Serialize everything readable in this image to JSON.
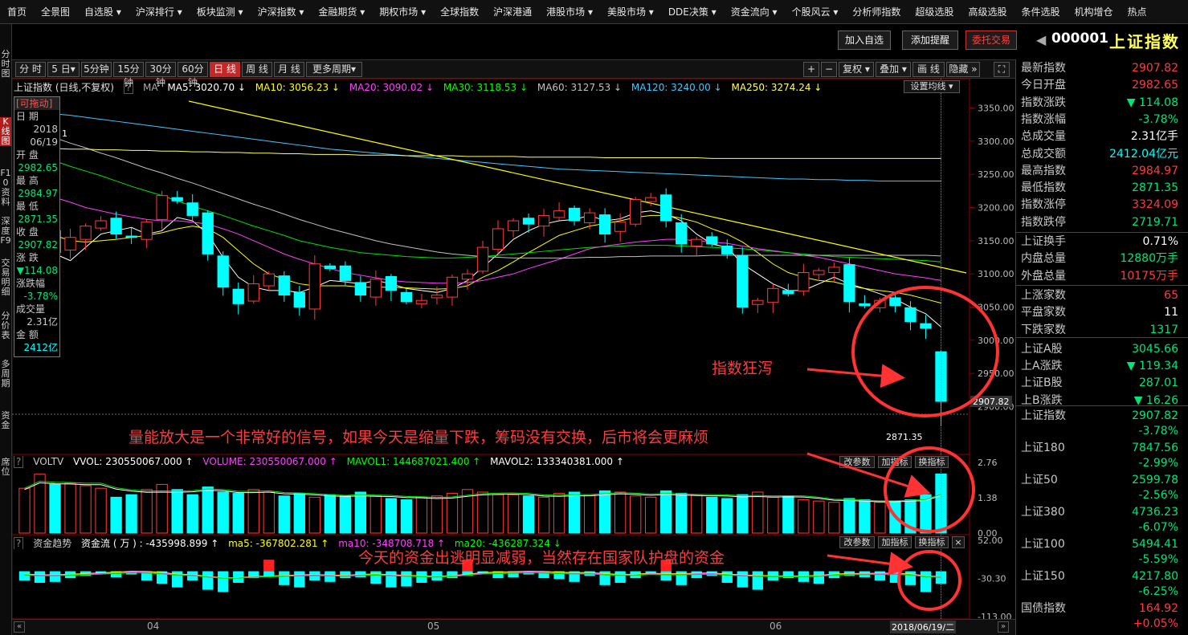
{
  "nav": [
    "首页",
    "全景图",
    "自选股 ▾",
    "沪深排行 ▾",
    "板块监测 ▾",
    "沪深指数 ▾",
    "金融期货 ▾",
    "期权市场 ▾",
    "全球指数",
    "沪深港通",
    "港股市场 ▾",
    "美股市场 ▾",
    "DDE决策 ▾",
    "资金流向 ▾",
    "个股风云 ▾",
    "分析师指数",
    "超级选股",
    "高级选股",
    "条件选股",
    "机构增仓",
    "热点"
  ],
  "leftbar": [
    "分时图",
    "K线图",
    "F10资料",
    "深度F9",
    "交易明细",
    "分价表",
    "多周期",
    "资金",
    "席位"
  ],
  "header": {
    "add_watch": "加入自选",
    "add_alert": "添加提醒",
    "trade": "委托交易",
    "code": "000001",
    "name": "上证指数"
  },
  "periods": [
    "分 时",
    "5 日▾",
    "5分钟",
    "15分钟",
    "30分钟",
    "60分钟",
    "日 线",
    "周 线",
    "月 线",
    "更多周期▾"
  ],
  "tools": [
    "+",
    "−",
    "复权 ▾",
    "叠加 ▾",
    "画 线",
    "隐藏 »"
  ],
  "ma_line": {
    "title": "上证指数 (日线,不复权)",
    "q": "?",
    "ma": "MA",
    "ma5": "MA5: 3020.70 ↓",
    "ma10": "MA10: 3056.23 ↓",
    "ma20": "MA20: 3090.02 ↓",
    "ma30": "MA30: 3118.53 ↓",
    "ma60": "MA60: 3127.53 ↓",
    "ma120": "MA120: 3240.00 ↓",
    "ma250": "MA250: 3274.24 ↓",
    "setting": "设置均线 ▾",
    "note": "1"
  },
  "info": {
    "drag": "[可拖动]",
    "date_lbl": "日  期",
    "year": "2018",
    "date": "06/19",
    "open_lbl": "开  盘",
    "open": "2982.65",
    "high_lbl": "最  高",
    "high": "2984.97",
    "low_lbl": "最  低",
    "low": "2871.35",
    "close_lbl": "收  盘",
    "close": "2907.82",
    "chg_lbl": "涨  跌",
    "chg": "▼114.08",
    "pct_lbl": "涨跌幅",
    "pct": "-3.78%",
    "vol_lbl": "成交量",
    "vol": "2.31亿",
    "amt_lbl": "金  额",
    "amt": "2412亿"
  },
  "price_axis": [
    "3350.00",
    "3300.00",
    "3250.00",
    "3200.00",
    "3150.00",
    "3100.00",
    "3050.00",
    "3000.00",
    "2950.00",
    "2900.00"
  ],
  "price_tag": "2907.82",
  "low_tag": "2871.35",
  "vol": {
    "name": "VOLTV",
    "vvol": "VVOL: 230550067.000 ↑",
    "volume": "VOLUME: 230550067.000 ↑",
    "mavol1": "MAVOL1: 144687021.400 ↑",
    "mavol2": "MAVOL2: 133340381.000 ↑",
    "axis": [
      "2.76",
      "1.38",
      "0.00"
    ]
  },
  "fund": {
    "name": "资金趋势",
    "flow": "资金流 ( 万 ) : -435998.899 ↑",
    "ma5": "ma5: -367802.281 ↑",
    "ma10": "ma10: -348708.718 ↑",
    "ma20": "ma20: -436287.324 ↓",
    "axis": [
      "52.00",
      "-30.30",
      "-113.00"
    ]
  },
  "sub_btns": [
    "改参数",
    "加指标",
    "换指标",
    "×"
  ],
  "dates": [
    "04",
    "05",
    "06",
    "2018/06/19/二"
  ],
  "anno": {
    "a1": "指数狂泻",
    "a2": "量能放大是一个非常好的信号，如果今天是缩量下跌，筹码没有交换，后市将会更麻烦",
    "a3": "今天的资金出逃明显减弱，当然存在国家队护盘的资金"
  },
  "quote": [
    {
      "l": "最新指数",
      "v": "2907.82",
      "c": "up"
    },
    {
      "l": "今日开盘",
      "v": "2982.65",
      "c": "up"
    },
    {
      "l": "指数涨跌",
      "v": "▼ 114.08",
      "c": "down"
    },
    {
      "l": "指数涨幅",
      "v": "-3.78%",
      "c": "down"
    },
    {
      "l": "总成交量",
      "v": "2.31亿手",
      "c": "wht"
    },
    {
      "l": "总成交额",
      "v": "2412.04亿元",
      "c": "cyan"
    },
    {
      "l": "最高指数",
      "v": "2984.97",
      "c": "up"
    },
    {
      "l": "最低指数",
      "v": "2871.35",
      "c": "down"
    },
    {
      "l": "指数涨停",
      "v": "3324.09",
      "c": "up"
    },
    {
      "l": "指数跌停",
      "v": "2719.71",
      "c": "down"
    },
    {
      "l": "上证换手",
      "v": "0.71%",
      "c": "wht"
    },
    {
      "l": "内盘总量",
      "v": "12880万手",
      "c": "down"
    },
    {
      "l": "外盘总量",
      "v": "10175万手",
      "c": "up"
    },
    {
      "l": "上涨家数",
      "v": "65",
      "c": "up"
    },
    {
      "l": "平盘家数",
      "v": "11",
      "c": "wht"
    },
    {
      "l": "下跌家数",
      "v": "1317",
      "c": "down"
    },
    {
      "l": "上证A股",
      "v": "3045.66",
      "c": "down"
    },
    {
      "l": "上A涨跌",
      "v": "▼ 119.34",
      "c": "down"
    },
    {
      "l": "上证B股",
      "v": "287.01",
      "c": "down"
    },
    {
      "l": "上B涨跌",
      "v": "▼ 16.26",
      "c": "down"
    }
  ],
  "indices": [
    {
      "l": "上证指数",
      "v": "2907.82",
      "p": "-3.78%"
    },
    {
      "l": "上证180",
      "v": "7847.56",
      "p": "-2.99%"
    },
    {
      "l": "上证50",
      "v": "2599.78",
      "p": "-2.56%"
    },
    {
      "l": "上证380",
      "v": "4736.23",
      "p": "-6.07%"
    },
    {
      "l": "上证100",
      "v": "5494.41",
      "p": "-5.59%"
    },
    {
      "l": "上证150",
      "v": "4217.80",
      "p": "-6.25%"
    },
    {
      "l": "国债指数",
      "v": "164.92",
      "p": "+0.05%"
    }
  ],
  "chart_data": {
    "type": "candlestick",
    "ylim": [
      2880,
      3370
    ],
    "close": [
      3130,
      3168,
      3132,
      3155,
      3172,
      3180,
      3160,
      3155,
      3178,
      3218,
      3210,
      3188,
      3130,
      3080,
      3055,
      3085,
      3100,
      3068,
      3050,
      3115,
      3108,
      3090,
      3068,
      3092,
      3075,
      3058,
      3060,
      3068,
      3095,
      3100,
      3140,
      3168,
      3180,
      3175,
      3188,
      3195,
      3180,
      3192,
      3160,
      3178,
      3212,
      3215,
      3180,
      3145,
      3152,
      3145,
      3130,
      3050,
      3060,
      3078,
      3070,
      3102,
      3105,
      3110,
      3058,
      3052,
      3060,
      3052,
      3028,
      3018,
      2907.82
    ],
    "volume": [
      1.75,
      2.3,
      1.9,
      1.95,
      1.85,
      1.75,
      1.4,
      1.5,
      1.7,
      1.9,
      1.7,
      1.5,
      1.8,
      1.6,
      1.55,
      1.7,
      1.6,
      1.45,
      1.55,
      1.4,
      1.5,
      1.45,
      1.6,
      1.45,
      1.35,
      1.3,
      1.4,
      1.45,
      1.55,
      1.7,
      1.6,
      1.5,
      1.5,
      1.45,
      1.4,
      1.55,
      1.6,
      1.5,
      1.65,
      1.6,
      1.45,
      1.4,
      1.65,
      1.55,
      1.5,
      1.4,
      1.35,
      1.5,
      1.6,
      1.4,
      1.45,
      1.3,
      1.25,
      1.2,
      1.35,
      1.3,
      1.2,
      1.25,
      1.3,
      1.5,
      2.31
    ],
    "fund": [
      -35,
      -40,
      -38,
      -30,
      -25,
      -20,
      -28,
      -22,
      -35,
      -42,
      -50,
      -35,
      -55,
      -60,
      -40,
      -30,
      -25,
      -45,
      -50,
      -35,
      -38,
      -30,
      -28,
      -42,
      -50,
      -48,
      -40,
      -35,
      -30,
      -25,
      -20,
      -30,
      -28,
      -22,
      -30,
      -32,
      -38,
      -25,
      -45,
      -40,
      -30,
      -20,
      -35,
      -45,
      -30,
      -25,
      -40,
      -50,
      -55,
      -35,
      -30,
      -38,
      -42,
      -30,
      -25,
      -28,
      -35,
      -40,
      -45,
      -60,
      -42
    ],
    "ma5": [
      3150,
      3140,
      3130,
      3120,
      3140,
      3160,
      3165,
      3170,
      3160,
      3165,
      3185,
      3180,
      3160,
      3125,
      3095,
      3080,
      3075,
      3075,
      3072,
      3080,
      3090,
      3088,
      3085,
      3090,
      3085,
      3078,
      3075,
      3072,
      3078,
      3090,
      3110,
      3130,
      3152,
      3165,
      3175,
      3180,
      3182,
      3188,
      3180,
      3183,
      3192,
      3195,
      3190,
      3180,
      3160,
      3145,
      3140,
      3115,
      3100,
      3085,
      3075,
      3075,
      3085,
      3095,
      3085,
      3078,
      3070,
      3062,
      3050,
      3040,
      3020
    ],
    "ma10": [
      3170,
      3165,
      3158,
      3150,
      3148,
      3150,
      3152,
      3155,
      3158,
      3162,
      3168,
      3172,
      3168,
      3155,
      3135,
      3115,
      3100,
      3092,
      3085,
      3082,
      3082,
      3082,
      3080,
      3080,
      3080,
      3079,
      3078,
      3077,
      3078,
      3082,
      3095,
      3105,
      3118,
      3132,
      3145,
      3158,
      3165,
      3172,
      3176,
      3180,
      3185,
      3188,
      3188,
      3184,
      3178,
      3168,
      3160,
      3148,
      3132,
      3115,
      3102,
      3095,
      3090,
      3088,
      3082,
      3078,
      3075,
      3072,
      3068,
      3062,
      3056
    ],
    "ma20": [
      3230,
      3222,
      3215,
      3208,
      3200,
      3195,
      3190,
      3186,
      3182,
      3180,
      3180,
      3178,
      3175,
      3168,
      3160,
      3150,
      3140,
      3130,
      3122,
      3115,
      3108,
      3102,
      3098,
      3094,
      3090,
      3088,
      3087,
      3086,
      3086,
      3087,
      3090,
      3095,
      3100,
      3108,
      3115,
      3122,
      3130,
      3138,
      3142,
      3145,
      3148,
      3150,
      3152,
      3152,
      3150,
      3148,
      3146,
      3142,
      3138,
      3135,
      3132,
      3128,
      3125,
      3120,
      3115,
      3110,
      3105,
      3100,
      3097,
      3094,
      3090
    ],
    "ma30": [
      3290,
      3280,
      3270,
      3262,
      3255,
      3248,
      3240,
      3232,
      3225,
      3218,
      3210,
      3202,
      3195,
      3188,
      3180,
      3172,
      3165,
      3158,
      3150,
      3145,
      3140,
      3136,
      3132,
      3130,
      3128,
      3126,
      3125,
      3124,
      3124,
      3125,
      3126,
      3128,
      3130,
      3132,
      3134,
      3136,
      3138,
      3140,
      3141,
      3142,
      3143,
      3143,
      3143,
      3142,
      3141,
      3140,
      3139,
      3138,
      3136,
      3134,
      3132,
      3130,
      3128,
      3126,
      3125,
      3124,
      3123,
      3122,
      3121,
      3120,
      3118
    ],
    "ma60": [
      3320,
      3312,
      3305,
      3297,
      3290,
      3282,
      3275,
      3267,
      3259,
      3252,
      3244,
      3237,
      3229,
      3221,
      3213,
      3205,
      3198,
      3190,
      3182,
      3175,
      3168,
      3162,
      3156,
      3150,
      3145,
      3141,
      3137,
      3133,
      3130,
      3128,
      3126,
      3125,
      3124,
      3124,
      3124,
      3124,
      3124,
      3125,
      3125,
      3126,
      3126,
      3127,
      3127,
      3127,
      3127,
      3128,
      3128,
      3128,
      3128,
      3128,
      3128,
      3128,
      3128,
      3128,
      3128,
      3128,
      3128,
      3128,
      3128,
      3128,
      3127
    ],
    "ma120": [
      3345,
      3343,
      3341,
      3339,
      3336,
      3333,
      3330,
      3327,
      3324,
      3321,
      3318,
      3315,
      3312,
      3309,
      3306,
      3303,
      3300,
      3297,
      3294,
      3291,
      3288,
      3286,
      3284,
      3282,
      3280,
      3278,
      3276,
      3274,
      3272,
      3270,
      3268,
      3266,
      3264,
      3262,
      3260,
      3258,
      3257,
      3256,
      3255,
      3254,
      3253,
      3252,
      3251,
      3250,
      3249,
      3248,
      3247,
      3246,
      3245,
      3244,
      3243,
      3243,
      3242,
      3242,
      3241,
      3241,
      3240,
      3240,
      3240,
      3240,
      3240
    ],
    "ma250": [
      3290,
      3289,
      3289,
      3288,
      3288,
      3287,
      3287,
      3286,
      3286,
      3285,
      3285,
      3284,
      3284,
      3283,
      3283,
      3282,
      3282,
      3281,
      3281,
      3280,
      3280,
      3280,
      3279,
      3279,
      3279,
      3278,
      3278,
      3278,
      3278,
      3277,
      3277,
      3277,
      3277,
      3276,
      3276,
      3276,
      3276,
      3276,
      3275,
      3275,
      3275,
      3275,
      3275,
      3275,
      3275,
      3274,
      3274,
      3274,
      3274,
      3274,
      3274,
      3274,
      3274,
      3274,
      3274,
      3274,
      3274,
      3274,
      3274,
      3274,
      3274
    ]
  }
}
